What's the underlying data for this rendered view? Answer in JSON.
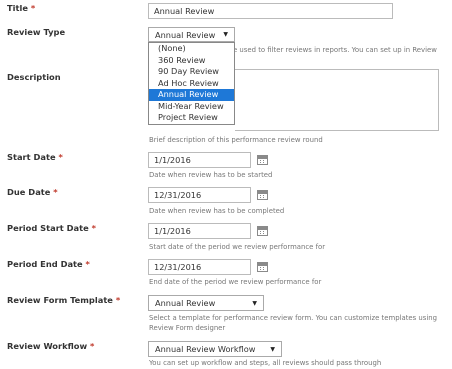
{
  "form": {
    "title": {
      "label": "Title",
      "value": "Annual Review"
    },
    "review_type": {
      "label": "Review Type",
      "selected": "Annual Review",
      "help_visible": "e used to filter reviews in reports. You can set up in Review",
      "options": [
        "(None)",
        "360 Review",
        "90 Day Review",
        "Ad Hoc Review",
        "Annual Review",
        "Mid-Year Review",
        "Project Review"
      ],
      "highlighted": "Annual Review"
    },
    "description": {
      "label": "Description",
      "help": "Brief description of this performance review round"
    },
    "start_date": {
      "label": "Start Date",
      "value": "1/1/2016",
      "help": "Date when review has to be started"
    },
    "due_date": {
      "label": "Due Date",
      "value": "12/31/2016",
      "help": "Date when review has to be completed"
    },
    "period_start_date": {
      "label": "Period Start Date",
      "value": "1/1/2016",
      "help": "Start date of the period we review performance for"
    },
    "period_end_date": {
      "label": "Period End Date",
      "value": "12/31/2016",
      "help": "End date of the period we review performance for"
    },
    "review_form_template": {
      "label": "Review Form Template",
      "selected": "Annual Review",
      "help": "Select a template for performance review form. You can customize templates using Review Form designer"
    },
    "review_workflow": {
      "label": "Review Workflow",
      "selected": "Annual Review Workflow",
      "help": "You can set up workflow and steps, all reviews should pass through"
    },
    "required_marker": "*"
  },
  "icons": {
    "date_picker": "calendar-icon",
    "select_caret": "chevron-down-icon"
  },
  "colors": {
    "required": "#c0392b",
    "highlight": "#1e78d7"
  }
}
